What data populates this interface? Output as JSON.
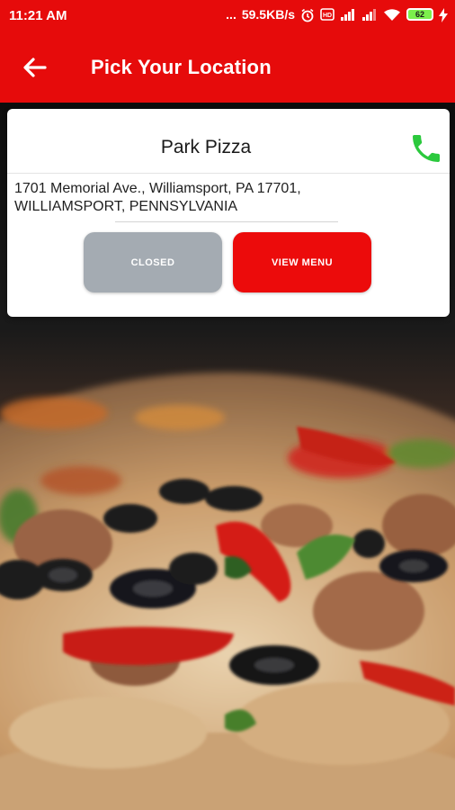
{
  "status_bar": {
    "time": "11:21 AM",
    "dots": "...",
    "network_speed": "59.5KB/s",
    "battery_level": "62",
    "icons": [
      "alarm-icon",
      "volte-icon",
      "signal-icon",
      "signal-icon",
      "wifi-icon",
      "battery-icon",
      "charging-icon"
    ]
  },
  "app_bar": {
    "title": "Pick Your Location",
    "back_icon": "arrow-left-icon"
  },
  "location": {
    "name": "Park Pizza",
    "address_line1": "1701 Memorial Ave., Williamsport, PA 17701,",
    "address_line2": "WILLIAMSPORT, PENNSYLVANIA",
    "phone_icon": "phone-icon",
    "closed_label": "CLOSED",
    "menu_label": "VIEW MENU"
  },
  "colors": {
    "primary": "#e60b0b",
    "phone": "#2bc93d",
    "closed_button": "#a4abb2",
    "menu_button": "#ec0b0b"
  }
}
